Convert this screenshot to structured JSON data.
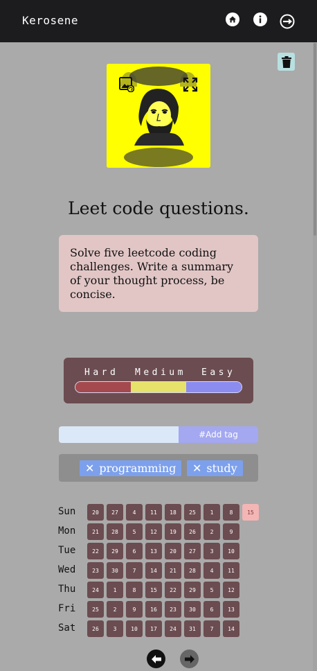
{
  "app": {
    "title": "Kerosene"
  },
  "nav": {
    "home_icon": "home-icon",
    "info_icon": "info-icon",
    "logout_icon": "logout-icon"
  },
  "task": {
    "title": "Leet code questions.",
    "description": "Solve five leetcode coding challenges. Write a summary of your thought process, be concise.",
    "image_background": "#ffff00"
  },
  "difficulty": {
    "labels": [
      "Hard",
      "Medium",
      "Easy"
    ],
    "colors": [
      "#a44a4e",
      "#e6e26a",
      "#8c8cf0"
    ]
  },
  "tags": {
    "input_value": "",
    "add_label": "#Add tag",
    "items": [
      {
        "label": "programming",
        "remove": "✕"
      },
      {
        "label": "study",
        "remove": "✕"
      }
    ]
  },
  "calendar": {
    "days": [
      {
        "name": "Sun",
        "dates": [
          "20",
          "27",
          "4",
          "11",
          "18",
          "25",
          "1",
          "8",
          "15"
        ]
      },
      {
        "name": "Mon",
        "dates": [
          "21",
          "28",
          "5",
          "12",
          "19",
          "26",
          "2",
          "9"
        ]
      },
      {
        "name": "Tue",
        "dates": [
          "22",
          "29",
          "6",
          "13",
          "20",
          "27",
          "3",
          "10"
        ]
      },
      {
        "name": "Wed",
        "dates": [
          "23",
          "30",
          "7",
          "14",
          "21",
          "28",
          "4",
          "11"
        ]
      },
      {
        "name": "Thu",
        "dates": [
          "24",
          "1",
          "8",
          "15",
          "22",
          "29",
          "5",
          "12"
        ]
      },
      {
        "name": "Fri",
        "dates": [
          "25",
          "2",
          "9",
          "16",
          "23",
          "30",
          "6",
          "13"
        ]
      },
      {
        "name": "Sat",
        "dates": [
          "26",
          "3",
          "10",
          "17",
          "24",
          "31",
          "7",
          "14"
        ]
      }
    ],
    "today": "15",
    "cell_color": "#6b4c50",
    "today_color": "#f4b5b5"
  }
}
